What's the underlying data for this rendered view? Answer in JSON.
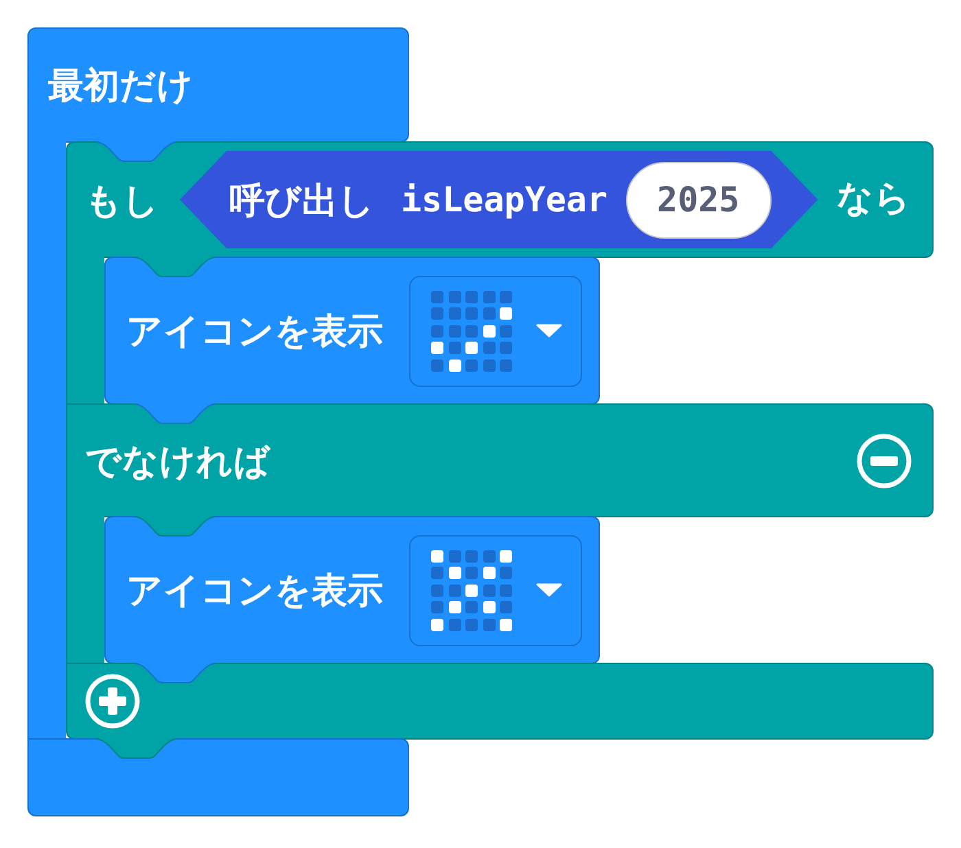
{
  "on_start_block": {
    "label": "最初だけ",
    "if_block": {
      "if_label": "もし",
      "condition": {
        "label": "呼び出し",
        "function": "isLeapYear",
        "argument": "2025"
      },
      "then_label": "なら",
      "then": [
        {
          "kind": "show_icon",
          "label": "アイコンを表示",
          "leds": [
            [
              false,
              false,
              false,
              false,
              false
            ],
            [
              false,
              false,
              false,
              false,
              true
            ],
            [
              false,
              false,
              false,
              true,
              false
            ],
            [
              true,
              false,
              true,
              false,
              false
            ],
            [
              false,
              true,
              false,
              false,
              false
            ]
          ]
        }
      ],
      "else_label": "でなければ",
      "else": [
        {
          "kind": "show_icon",
          "label": "アイコンを表示",
          "leds": [
            [
              true,
              false,
              false,
              false,
              true
            ],
            [
              false,
              true,
              false,
              true,
              false
            ],
            [
              false,
              false,
              true,
              false,
              false
            ],
            [
              false,
              true,
              false,
              true,
              false
            ],
            [
              true,
              false,
              false,
              false,
              true
            ]
          ]
        }
      ]
    }
  }
}
